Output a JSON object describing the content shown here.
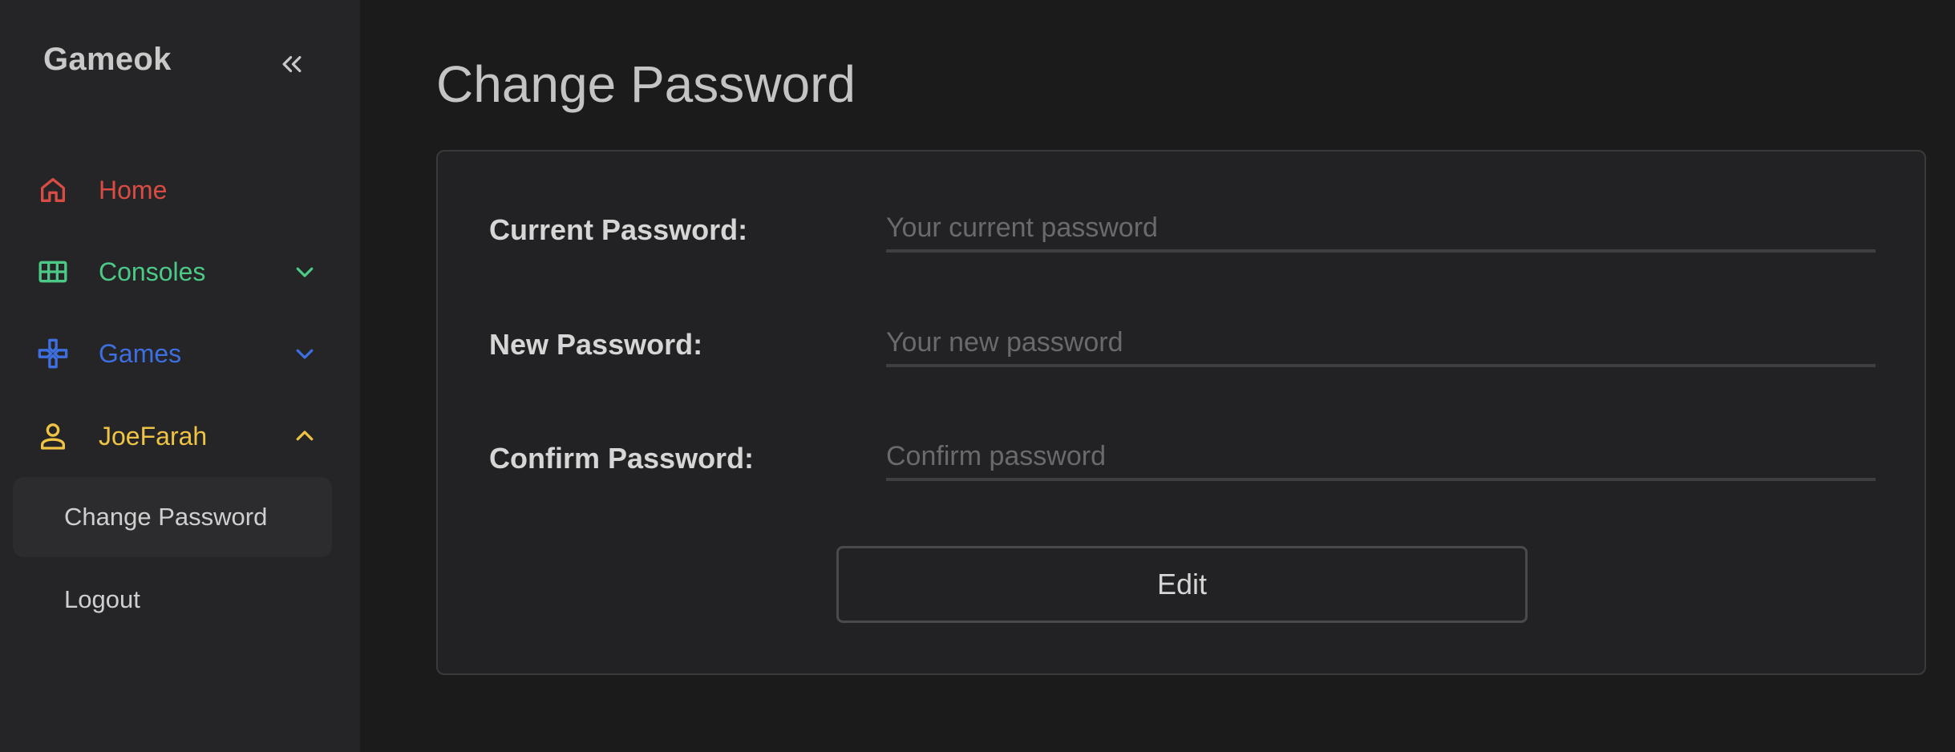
{
  "sidebar": {
    "brand": "Gameok",
    "collapse_icon": "double-chevron-left-icon",
    "items": [
      {
        "label": "Home",
        "icon": "home-icon",
        "color": "#d94c44"
      },
      {
        "label": "Consoles",
        "icon": "grid-icon",
        "color": "#4cc986",
        "expand": "chevron-down-icon"
      },
      {
        "label": "Games",
        "icon": "gamepad-icon",
        "color": "#3d6fe0",
        "expand": "chevron-down-icon"
      },
      {
        "label": "JoeFarah",
        "icon": "user-icon",
        "color": "#efc444",
        "expand": "chevron-up-icon"
      }
    ],
    "sub_items": [
      {
        "label": "Change Password",
        "active": true
      },
      {
        "label": "Logout"
      }
    ]
  },
  "main": {
    "title": "Change Password",
    "form": {
      "fields": [
        {
          "label": "Current Password:",
          "value": "",
          "placeholder": "Your current password"
        },
        {
          "label": "New Password:",
          "value": "",
          "placeholder": "Your new password"
        },
        {
          "label": "Confirm Password:",
          "value": "",
          "placeholder": "Confirm password"
        }
      ],
      "submit_label": "Edit"
    }
  }
}
